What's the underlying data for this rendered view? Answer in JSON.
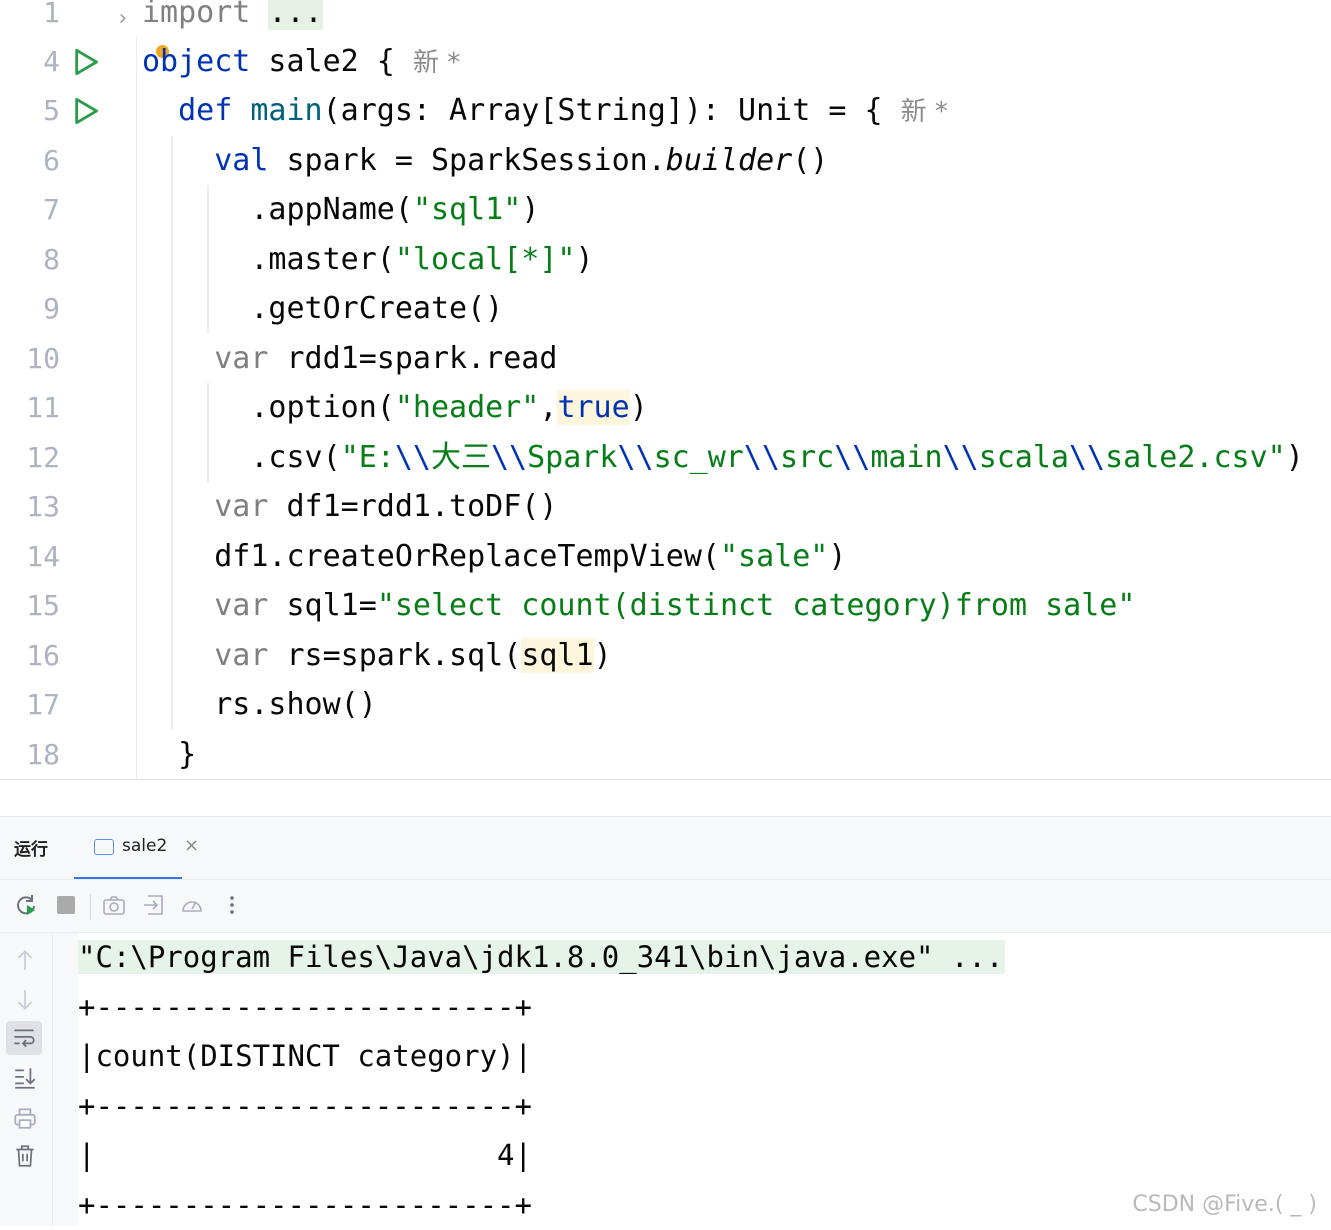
{
  "editor": {
    "lines": [
      {
        "num": "1",
        "segments": [
          {
            "t": "import",
            "c": "gray"
          },
          {
            "t": " "
          },
          {
            "t": "...",
            "c": "hl-fold"
          }
        ]
      },
      {
        "num": "4",
        "run": true,
        "segments": [
          {
            "t": "object",
            "c": "kw"
          },
          {
            "t": " sale2 { "
          },
          {
            "t": "新 *",
            "c": "hint"
          }
        ]
      },
      {
        "num": "5",
        "run": true,
        "segments": [
          {
            "t": "  "
          },
          {
            "t": "def",
            "c": "kw"
          },
          {
            "t": " "
          },
          {
            "t": "main",
            "c": "fn"
          },
          {
            "t": "(args: Array[String]): Unit = { "
          },
          {
            "t": "新 *",
            "c": "hint"
          }
        ]
      },
      {
        "num": "6",
        "segments": [
          {
            "t": "    "
          },
          {
            "t": "val",
            "c": "kw"
          },
          {
            "t": " spark = SparkSession."
          },
          {
            "t": "builder",
            "c": "it"
          },
          {
            "t": "()"
          }
        ]
      },
      {
        "num": "7",
        "segments": [
          {
            "t": "      .appName("
          },
          {
            "t": "\"sql1\"",
            "c": "str"
          },
          {
            "t": ")"
          }
        ]
      },
      {
        "num": "8",
        "segments": [
          {
            "t": "      .master("
          },
          {
            "t": "\"local[*]\"",
            "c": "str"
          },
          {
            "t": ")"
          }
        ]
      },
      {
        "num": "9",
        "segments": [
          {
            "t": "      .getOrCreate()"
          }
        ]
      },
      {
        "num": "10",
        "segments": [
          {
            "t": "    "
          },
          {
            "t": "var",
            "c": "gray"
          },
          {
            "t": " rdd1=spark.read"
          }
        ]
      },
      {
        "num": "11",
        "segments": [
          {
            "t": "      .option("
          },
          {
            "t": "\"header\"",
            "c": "str"
          },
          {
            "t": ","
          },
          {
            "t": "true",
            "c": "kw hl"
          },
          {
            "t": ")"
          }
        ]
      },
      {
        "num": "12",
        "segments": [
          {
            "t": "      .csv("
          },
          {
            "t": "\"E:",
            "c": "str"
          },
          {
            "t": "\\\\",
            "c": "kw"
          },
          {
            "t": "大三",
            "c": "str"
          },
          {
            "t": "\\\\",
            "c": "kw"
          },
          {
            "t": "Spark",
            "c": "str"
          },
          {
            "t": "\\\\",
            "c": "kw"
          },
          {
            "t": "sc_wr",
            "c": "str"
          },
          {
            "t": "\\\\",
            "c": "kw"
          },
          {
            "t": "src",
            "c": "str"
          },
          {
            "t": "\\\\",
            "c": "kw"
          },
          {
            "t": "main",
            "c": "str"
          },
          {
            "t": "\\\\",
            "c": "kw"
          },
          {
            "t": "scala",
            "c": "str"
          },
          {
            "t": "\\\\",
            "c": "kw"
          },
          {
            "t": "sale2.csv\"",
            "c": "str"
          },
          {
            "t": ")"
          }
        ]
      },
      {
        "num": "13",
        "segments": [
          {
            "t": "    "
          },
          {
            "t": "var",
            "c": "gray"
          },
          {
            "t": " df1=rdd1.toDF()"
          }
        ]
      },
      {
        "num": "14",
        "segments": [
          {
            "t": "    df1.createOrReplaceTempView("
          },
          {
            "t": "\"sale\"",
            "c": "str"
          },
          {
            "t": ")"
          }
        ]
      },
      {
        "num": "15",
        "segments": [
          {
            "t": "    "
          },
          {
            "t": "var",
            "c": "gray"
          },
          {
            "t": " sql1="
          },
          {
            "t": "\"select count(distinct category)from sale\"",
            "c": "str"
          }
        ]
      },
      {
        "num": "16",
        "segments": [
          {
            "t": "    "
          },
          {
            "t": "var",
            "c": "gray"
          },
          {
            "t": " rs=spark.sql("
          },
          {
            "t": "sql1",
            "c": "hl"
          },
          {
            "t": ")"
          }
        ]
      },
      {
        "num": "17",
        "segments": [
          {
            "t": "    rs.show()"
          }
        ]
      },
      {
        "num": "18",
        "segments": [
          {
            "t": "  }"
          }
        ]
      }
    ]
  },
  "run_panel": {
    "title": "运行",
    "tab_label": "sale2",
    "tab_close": "×",
    "console_lines": [
      "\"C:\\Program Files\\Java\\jdk1.8.0_341\\bin\\java.exe\" ...",
      "+------------------------+",
      "|count(DISTINCT category)|",
      "+------------------------+",
      "|                       4|",
      "+------------------------+"
    ]
  },
  "watermark": "CSDN @Five.(  _  )",
  "colors": {
    "keyword": "#0033b3",
    "string": "#067d17",
    "function": "#00627a",
    "run_icon": "#2a9d4b",
    "accent": "#3574f0"
  }
}
